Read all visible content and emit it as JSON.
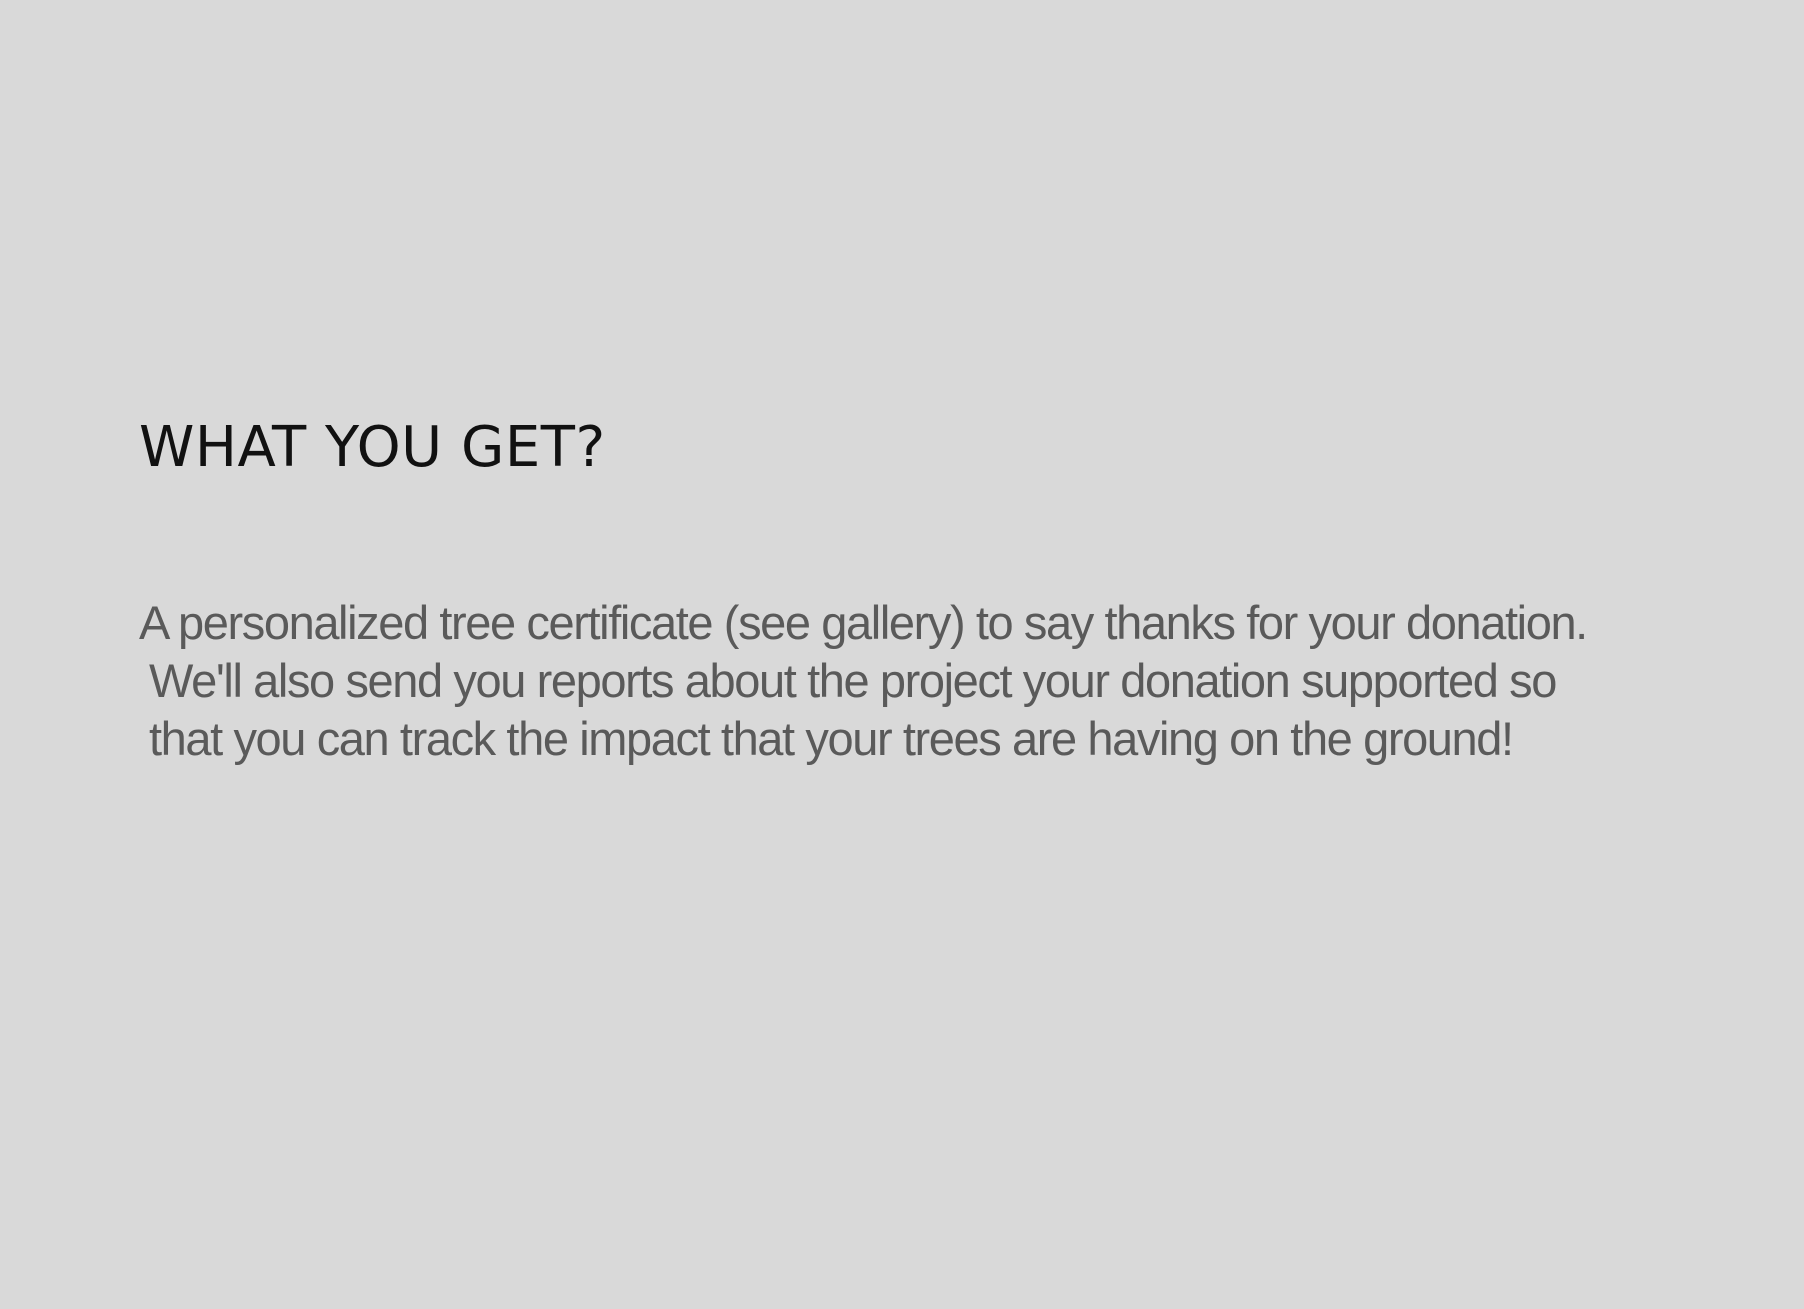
{
  "section": {
    "heading": "WHAT YOU GET?",
    "description_lines": [
      "A personalized tree certificate (see gallery) to say thanks for your donation.",
      "We'll also send you reports about the project your donation supported so",
      "that you can track the impact that your trees are having on the ground!"
    ]
  },
  "colors": {
    "background": "#d9d9d9",
    "heading": "#111111",
    "body_text": "#5a5a5a"
  }
}
